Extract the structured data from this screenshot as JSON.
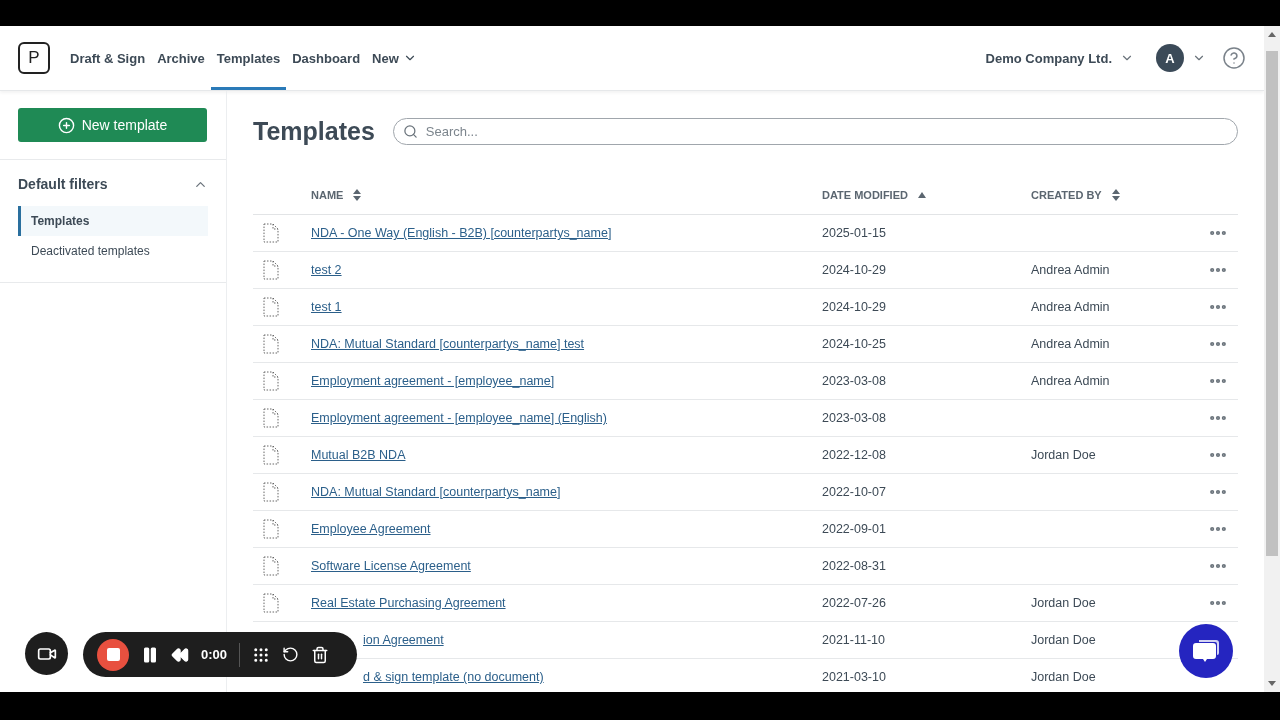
{
  "header": {
    "logo": "P",
    "nav": [
      {
        "label": "Draft & Sign",
        "selected": false
      },
      {
        "label": "Archive",
        "selected": false
      },
      {
        "label": "Templates",
        "selected": true
      },
      {
        "label": "Dashboard",
        "selected": false
      },
      {
        "label": "New",
        "selected": false,
        "dropdown": true
      }
    ],
    "company": "Demo Company Ltd.",
    "avatar": "A"
  },
  "sidebar": {
    "new_button": "New template",
    "filters_title": "Default filters",
    "expanded": true,
    "items": [
      {
        "label": "Templates",
        "selected": true
      },
      {
        "label": "Deactivated templates",
        "selected": false
      }
    ]
  },
  "main": {
    "title": "Templates",
    "search": {
      "placeholder": "Search..."
    }
  },
  "table": {
    "columns": [
      {
        "label": "NAME",
        "sorted": false
      },
      {
        "label": "DATE MODIFIED",
        "sorted": true
      },
      {
        "label": "CREATED BY",
        "sorted": false
      }
    ],
    "rows": [
      {
        "name": "NDA - One Way (English - B2B) [counterpartys_name]",
        "date": "2025-01-15"
      },
      {
        "name": "test 2",
        "date": "2024-10-29",
        "created_by": "Andrea Admin"
      },
      {
        "name": "test 1",
        "date": "2024-10-29",
        "created_by": "Andrea Admin"
      },
      {
        "name": "NDA: Mutual Standard [counterpartys_name] test",
        "date": "2024-10-25",
        "created_by": "Andrea Admin"
      },
      {
        "name": "Employment agreement - [employee_name]",
        "date": "2023-03-08",
        "created_by": "Andrea Admin"
      },
      {
        "name": "Employment agreement - [employee_name] (English)",
        "date": "2023-03-08"
      },
      {
        "name": "Mutual B2B NDA",
        "date": "2022-12-08",
        "created_by": "Jordan Doe"
      },
      {
        "name": "NDA: Mutual Standard [counterpartys_name]",
        "date": "2022-10-07"
      },
      {
        "name": "Employee Agreement",
        "date": "2022-09-01"
      },
      {
        "name": "Software License Agreement",
        "date": "2022-08-31"
      },
      {
        "name": "Real Estate Purchasing Agreement",
        "date": "2022-07-26",
        "created_by": "Jordan Doe"
      },
      {
        "name": "ion Agreement",
        "date": "2021-11-10",
        "created_by": "Jordan Doe",
        "covered": true
      },
      {
        "name": "d & sign template (no document)",
        "date": "2021-03-10",
        "created_by": "Jordan Doe",
        "covered": true
      }
    ]
  },
  "recorder": {
    "time": "0:00"
  }
}
